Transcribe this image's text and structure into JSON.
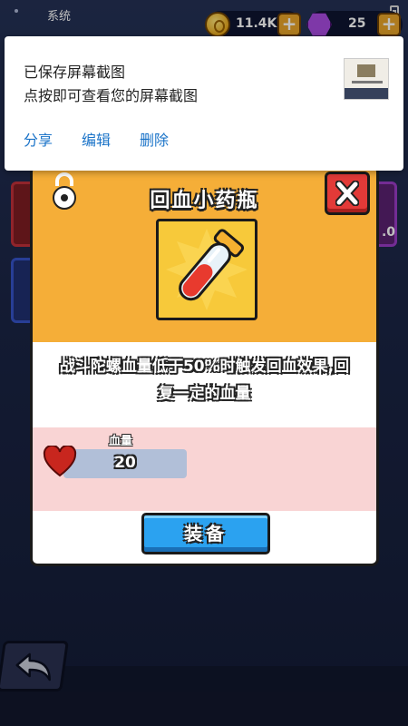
{
  "status_bar": {
    "app_title": "系统"
  },
  "hud": {
    "coins": "11.4K",
    "gems": "25",
    "plus": "+"
  },
  "background": {
    "side_value": ".0"
  },
  "notification": {
    "line1": "已保存屏幕截图",
    "line2": "点按即可查看您的屏幕截图",
    "actions": [
      "分享",
      "编辑",
      "删除"
    ]
  },
  "modal": {
    "title": "回血小药瓶",
    "description": "战斗陀螺血量低于50%时触发回血效果,回复一定的血量",
    "stat_label": "血量",
    "stat_value": "20",
    "equip_label": "装备"
  },
  "colors": {
    "header": "#f5ae38",
    "close": "#e23a38",
    "equip": "#2ba2f0",
    "stat_panel": "#f9d4d4"
  },
  "icons": [
    "lock-icon",
    "close-icon",
    "potion-icon",
    "heart-icon",
    "back-arrow-icon",
    "coin-icon",
    "gem-icon"
  ]
}
